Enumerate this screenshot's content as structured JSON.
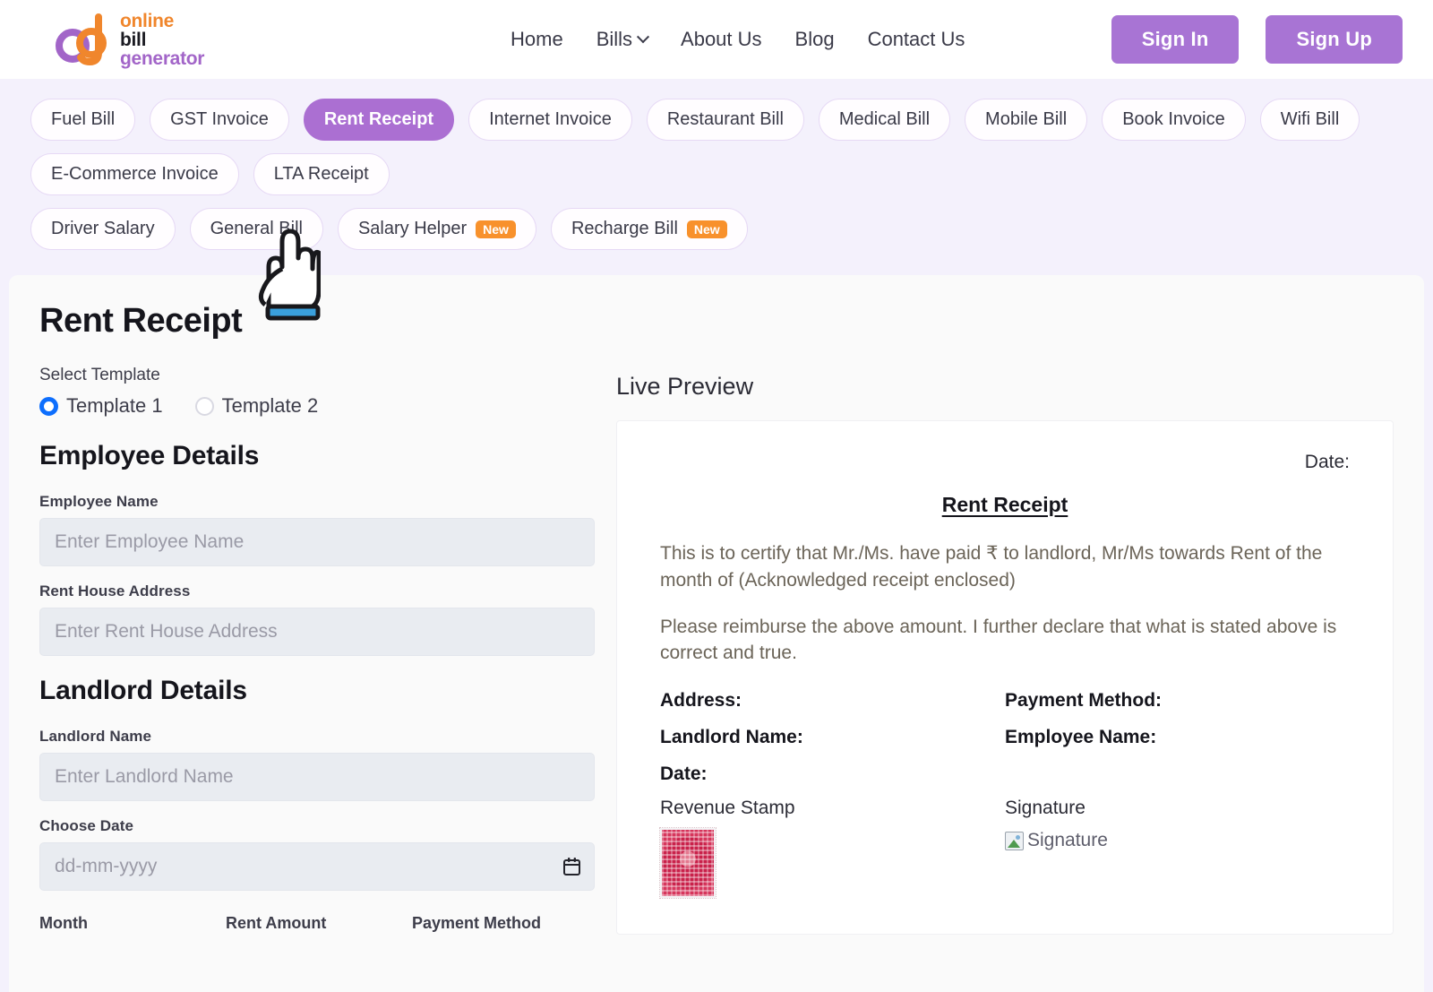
{
  "brand": {
    "name_line1": "online",
    "name_line2": "bill",
    "name_line3": "generator",
    "monogram": "obg",
    "color_orange": "#f0862c",
    "color_purple": "#a265c8",
    "color_dark": "#1b1b22"
  },
  "header": {
    "nav": [
      {
        "label": "Home",
        "has_chevron": false
      },
      {
        "label": "Bills",
        "has_chevron": true
      },
      {
        "label": "About Us",
        "has_chevron": false
      },
      {
        "label": "Blog",
        "has_chevron": false
      },
      {
        "label": "Contact Us",
        "has_chevron": false
      }
    ],
    "sign_in": "Sign In",
    "sign_up": "Sign Up",
    "button_color": "#a874d4"
  },
  "chips": {
    "active_color": "#ab6fd2",
    "badge_color": "#f8912c",
    "badge_text": "New",
    "row1": [
      {
        "label": "Fuel Bill",
        "active": false,
        "badge": false
      },
      {
        "label": "GST Invoice",
        "active": false,
        "badge": false
      },
      {
        "label": "Rent Receipt",
        "active": true,
        "badge": false
      },
      {
        "label": "Internet Invoice",
        "active": false,
        "badge": false
      },
      {
        "label": "Restaurant Bill",
        "active": false,
        "badge": false
      },
      {
        "label": "Medical Bill",
        "active": false,
        "badge": false
      },
      {
        "label": "Mobile Bill",
        "active": false,
        "badge": false
      },
      {
        "label": "Book Invoice",
        "active": false,
        "badge": false
      },
      {
        "label": "Wifi Bill",
        "active": false,
        "badge": false
      },
      {
        "label": "E-Commerce Invoice",
        "active": false,
        "badge": false
      },
      {
        "label": "LTA Receipt",
        "active": false,
        "badge": false
      }
    ],
    "row2": [
      {
        "label": "Driver Salary",
        "active": false,
        "badge": false
      },
      {
        "label": "General Bill",
        "active": false,
        "badge": false
      },
      {
        "label": "Salary Helper",
        "active": false,
        "badge": true
      },
      {
        "label": "Recharge Bill",
        "active": false,
        "badge": true
      }
    ]
  },
  "page": {
    "title": "Rent Receipt"
  },
  "template_select": {
    "label": "Select Template",
    "options": [
      {
        "label": "Template 1",
        "selected": true
      },
      {
        "label": "Template 2",
        "selected": false
      }
    ]
  },
  "employee_section": {
    "title": "Employee Details",
    "name_label": "Employee Name",
    "name_placeholder": "Enter Employee Name",
    "name_value": "",
    "address_label": "Rent House Address",
    "address_placeholder": "Enter Rent House Address",
    "address_value": ""
  },
  "landlord_section": {
    "title": "Landlord Details",
    "name_label": "Landlord Name",
    "name_placeholder": "Enter Landlord Name",
    "name_value": "",
    "date_label": "Choose Date",
    "date_placeholder": "dd-mm-yyyy",
    "date_value": ""
  },
  "rent_table": {
    "col_month": "Month",
    "col_amount": "Rent Amount",
    "col_payment": "Payment Method"
  },
  "preview": {
    "heading": "Live Preview",
    "date_label": "Date:",
    "doc_title": "Rent Receipt",
    "paragraph1": "This is to certify that Mr./Ms. have paid ₹ to landlord, Mr/Ms towards Rent of the month of (Acknowledged receipt enclosed)",
    "paragraph2": "Please reimburse the above amount. I further declare that what is stated above is correct and true.",
    "address_label": "Address:",
    "payment_method_label": "Payment Method:",
    "landlord_name_label": "Landlord Name:",
    "employee_name_label": "Employee Name:",
    "date_field_label": "Date:",
    "revenue_stamp_label": "Revenue Stamp",
    "signature_label": "Signature",
    "signature_broken_alt": "Signature"
  }
}
